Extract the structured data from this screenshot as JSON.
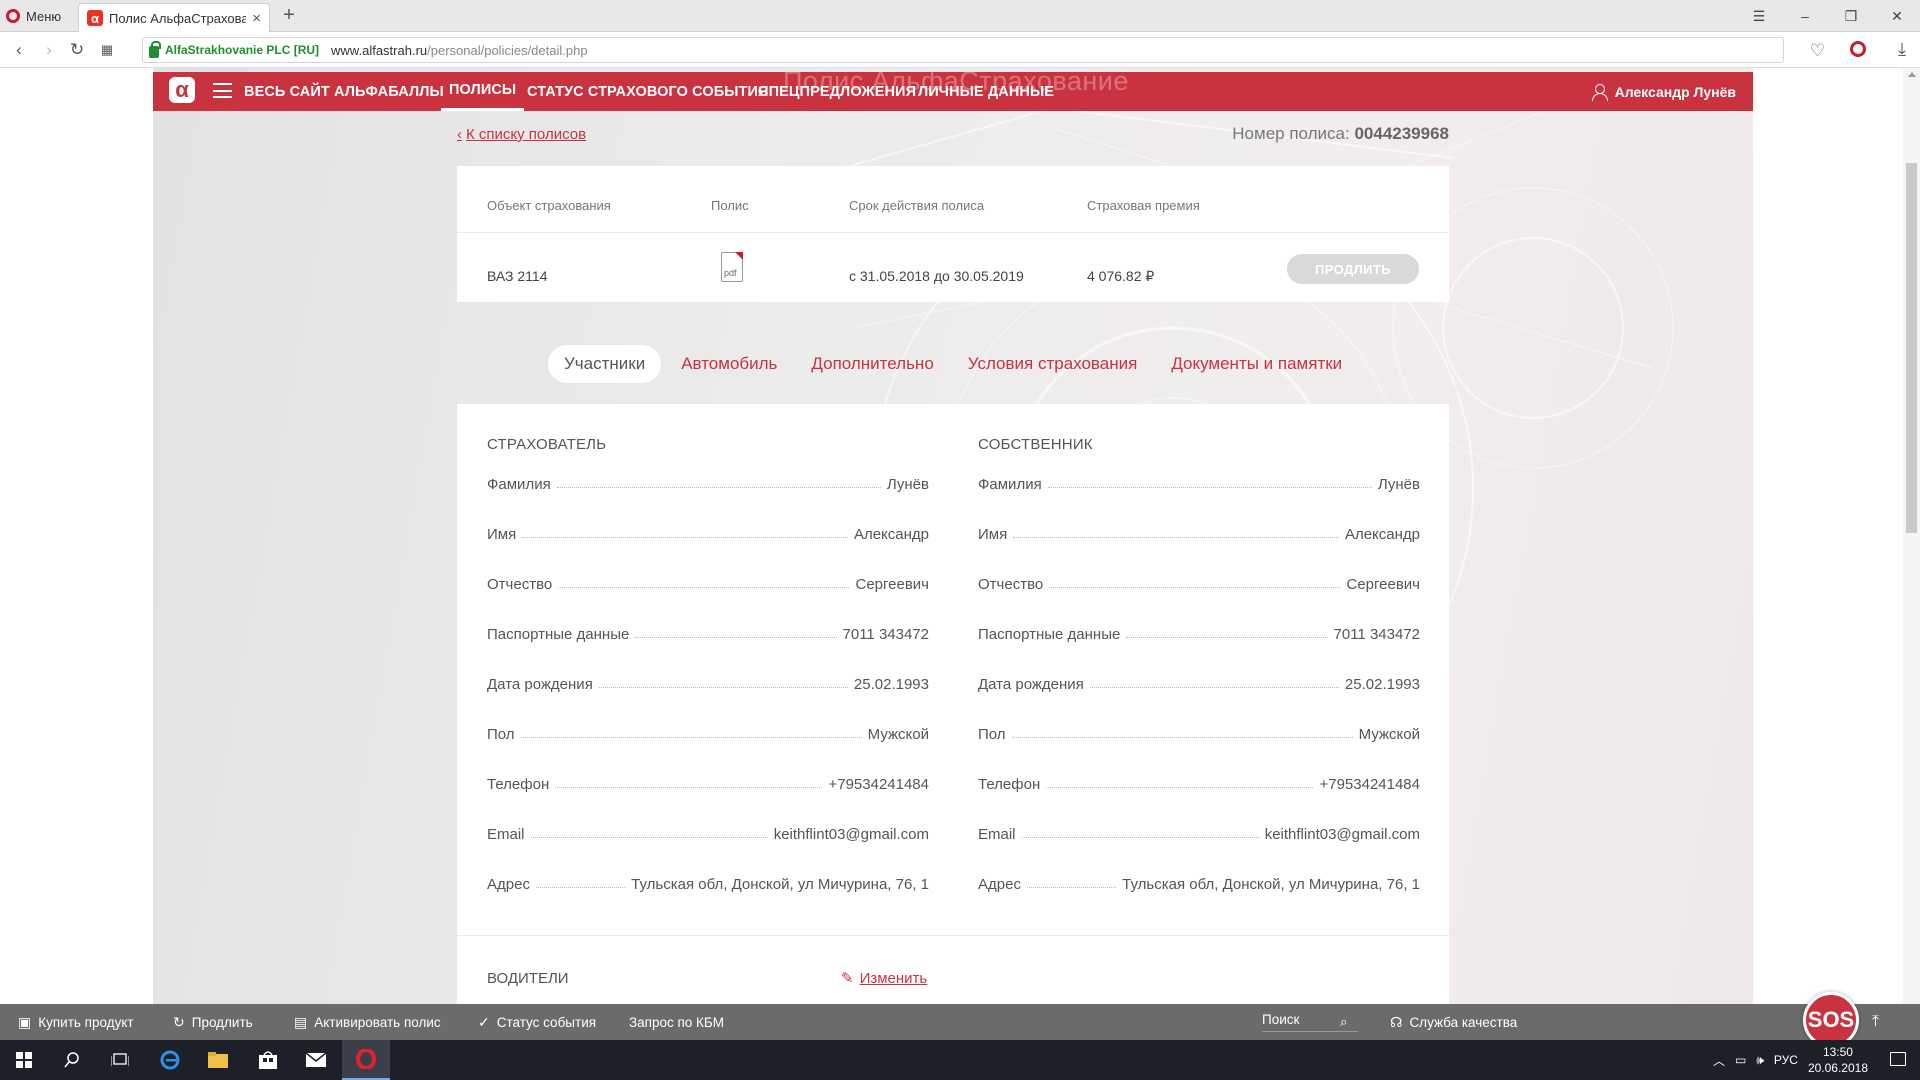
{
  "browser": {
    "menu_label": "Меню",
    "tab_title": "Полис АльфаСтрахование",
    "tab_close": "×",
    "new_tab": "+",
    "cert_label": "AlfaStrakhovanie PLC [RU]",
    "url_host": "www.alfastrah.ru",
    "url_path": "/personal/policies/detail.php"
  },
  "site": {
    "ghost_heading": "Полис АльфаСтрахование",
    "logo": "α",
    "nav": [
      "ВЕСЬ САЙТ",
      "АЛЬФАБАЛЛЫ",
      "ПОЛИСЫ",
      "СТАТУС СТРАХОВОГО СОБЫТИЯ",
      "СПЕЦПРЕДЛОЖЕНИЯ",
      "ЛИЧНЫЕ ДАННЫЕ"
    ],
    "nav_active": "ПОЛИСЫ",
    "user_name": "Александр Лунёв",
    "back_link": "К списку полисов",
    "policy_number_label": "Номер полиса:",
    "policy_number": "0044239968"
  },
  "policy_table": {
    "headers": [
      "Объект страхования",
      "Полис",
      "Срок действия полиса",
      "Страховая премия"
    ],
    "object": "ВАЗ 2114",
    "pdf_label": "pdf",
    "period": "с 31.05.2018 до 30.05.2019",
    "premium": "4 076.82 ₽",
    "renew_button": "ПРОДЛИТЬ"
  },
  "tabs": [
    "Участники",
    "Автомобиль",
    "Дополнительно",
    "Условия страхования",
    "Документы и памятки"
  ],
  "tab_active": "Участники",
  "insurer": {
    "title": "СТРАХОВАТЕЛЬ",
    "rows": [
      {
        "label": "Фамилия",
        "value": "Лунёв"
      },
      {
        "label": "Имя",
        "value": "Александр"
      },
      {
        "label": "Отчество",
        "value": "Сергеевич"
      },
      {
        "label": "Паспортные данные",
        "value": "7011 343472"
      },
      {
        "label": "Дата рождения",
        "value": "25.02.1993"
      },
      {
        "label": "Пол",
        "value": "Мужской"
      },
      {
        "label": "Телефон",
        "value": "+79534241484"
      },
      {
        "label": "Email",
        "value": "keithflint03@gmail.com"
      },
      {
        "label": "Адрес",
        "value": "Тульская обл, Донской, ул Мичурина, 76, 1"
      }
    ]
  },
  "owner": {
    "title": "СОБСТВЕННИК",
    "rows": [
      {
        "label": "Фамилия",
        "value": "Лунёв"
      },
      {
        "label": "Имя",
        "value": "Александр"
      },
      {
        "label": "Отчество",
        "value": "Сергеевич"
      },
      {
        "label": "Паспортные данные",
        "value": "7011 343472"
      },
      {
        "label": "Дата рождения",
        "value": "25.02.1993"
      },
      {
        "label": "Пол",
        "value": "Мужской"
      },
      {
        "label": "Телефон",
        "value": "+79534241484"
      },
      {
        "label": "Email",
        "value": "keithflint03@gmail.com"
      },
      {
        "label": "Адрес",
        "value": "Тульская обл, Донской, ул Мичурина, 76, 1"
      }
    ]
  },
  "drivers": {
    "title": "ВОДИТЕЛИ",
    "change_label": "Изменить"
  },
  "bottom_bar": {
    "buy": "Купить продукт",
    "renew": "Продлить",
    "activate": "Активировать полис",
    "status": "Статус события",
    "kbm": "Запрос по КБМ",
    "search_placeholder": "Поиск",
    "quality": "Служба качества",
    "sos": "SOS"
  },
  "taskbar": {
    "lang": "РУС",
    "time": "13:50",
    "date": "20.06.2018"
  },
  "colors": {
    "brand_red": "#c9333f",
    "cert_green": "#1e8f2e"
  }
}
